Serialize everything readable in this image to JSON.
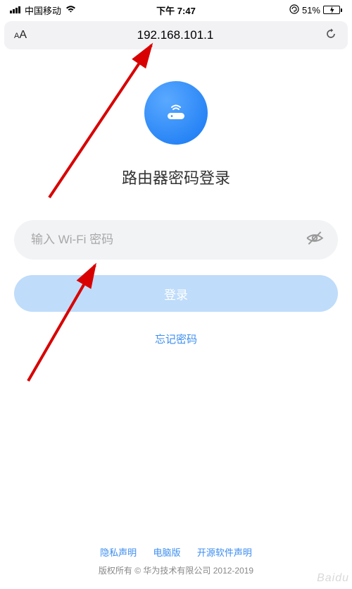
{
  "status_bar": {
    "carrier": "中国移动",
    "time": "下午 7:47",
    "battery_percent": "51%"
  },
  "browser": {
    "url": "192.168.101.1"
  },
  "page": {
    "title": "路由器密码登录",
    "password_placeholder": "输入 Wi-Fi 密码",
    "login_button": "登录",
    "forgot_password": "忘记密码"
  },
  "footer": {
    "privacy": "隐私声明",
    "desktop": "电脑版",
    "opensource": "开源软件声明",
    "copyright": "版权所有 © 华为技术有限公司 2012-2019"
  },
  "watermark": "Baidu"
}
